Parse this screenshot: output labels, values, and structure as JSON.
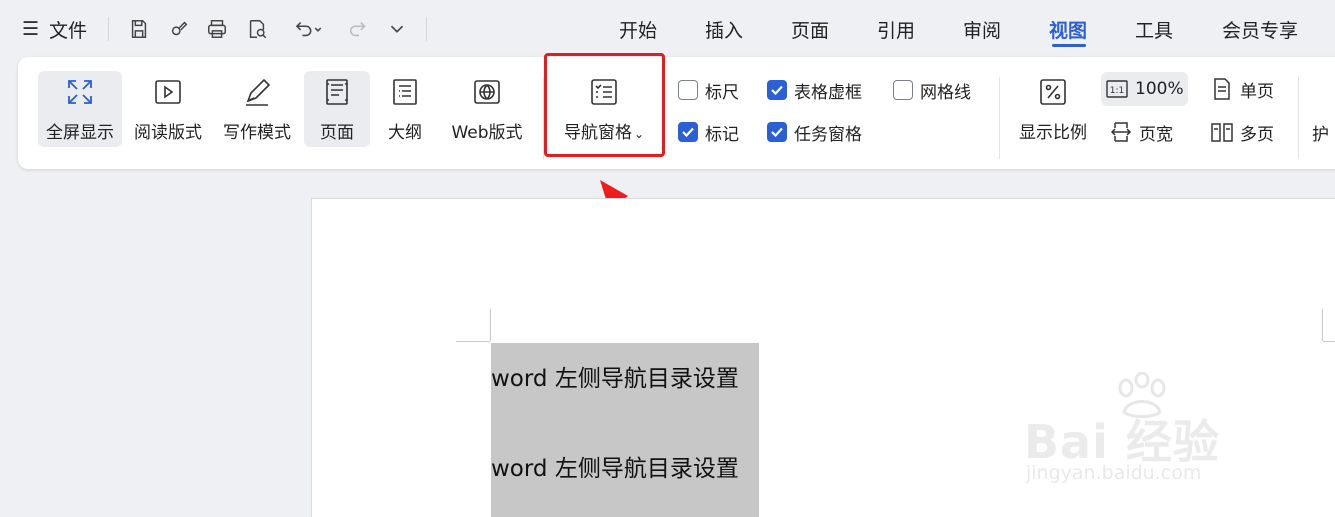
{
  "titlebar": {
    "file_label": "文件",
    "tabs": [
      {
        "label": "开始"
      },
      {
        "label": "插入"
      },
      {
        "label": "页面"
      },
      {
        "label": "引用"
      },
      {
        "label": "审阅"
      },
      {
        "label": "视图",
        "active": true
      },
      {
        "label": "工具"
      },
      {
        "label": "会员专享"
      }
    ]
  },
  "ribbon": {
    "buttons": {
      "fullscreen": "全屏显示",
      "read_mode": "阅读版式",
      "write_mode": "写作模式",
      "page": "页面",
      "outline": "大纲",
      "web": "Web版式",
      "nav_pane": "导航窗格"
    },
    "checkboxes": {
      "ruler": {
        "label": "标尺",
        "checked": false
      },
      "table_grid": {
        "label": "表格虚框",
        "checked": true
      },
      "gridlines": {
        "label": "网格线",
        "checked": false
      },
      "marks": {
        "label": "标记",
        "checked": true
      },
      "task_pane": {
        "label": "任务窗格",
        "checked": true
      }
    },
    "zoom": {
      "ratio_label": "显示比例",
      "percent_label": "100%",
      "page_width_label": "页宽",
      "single_page_label": "单页",
      "multi_page_label": "多页",
      "protect_label": "护"
    }
  },
  "document": {
    "lines": [
      "word 左侧导航目录设置",
      "word 左侧导航目录设置"
    ]
  },
  "watermark": {
    "brand": "Bai 经验",
    "site": "jingyan.baidu.com"
  },
  "colors": {
    "accent": "#2b5fd6",
    "highlight": "#e41e1e",
    "selection": "#c7c7c7"
  }
}
